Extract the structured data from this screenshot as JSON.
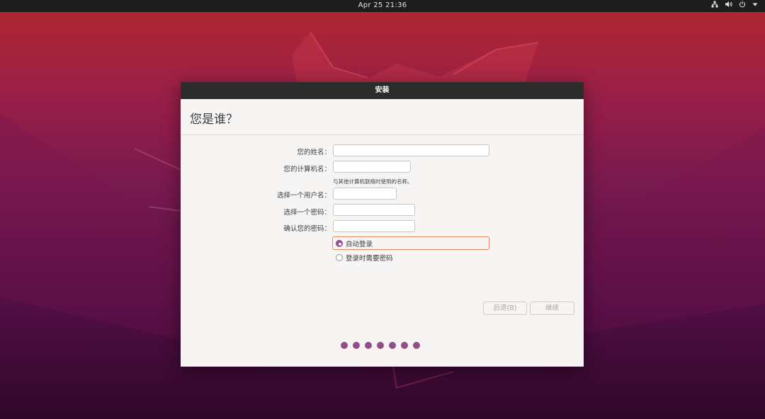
{
  "topbar": {
    "clock": "Apr 25  21:36",
    "tray_icons": [
      "network-icon",
      "volume-icon",
      "power-icon",
      "menu-arrow-icon"
    ]
  },
  "window": {
    "title": "安装",
    "heading": "您是谁？",
    "form": {
      "name_label": "您的姓名：",
      "name_value": "",
      "computer_label": "您的计算机名：",
      "computer_value": "",
      "computer_hint": "与其他计算机联络时使用的名称。",
      "username_label": "选择一个用户名：",
      "username_value": "",
      "password_label": "选择一个密码：",
      "password_value": "",
      "confirm_label": "确认您的密码：",
      "confirm_value": ""
    },
    "login_options": {
      "auto_login": "自动登录",
      "require_password": "登录时需要密码",
      "selected": "auto_login"
    },
    "buttons": {
      "back": "后退(B)",
      "continue": "继续"
    },
    "progress": {
      "total_steps": 7
    }
  },
  "colors": {
    "accent": "#924d8b",
    "focus": "#e9875f",
    "titlebar": "#2c2c2c"
  }
}
